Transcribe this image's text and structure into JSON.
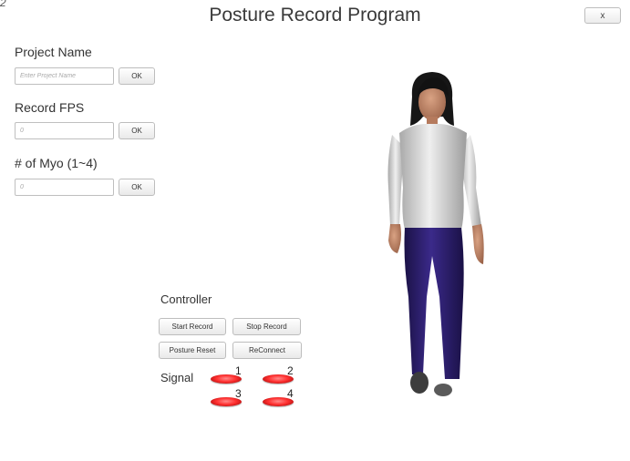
{
  "window": {
    "title": "Posture Record Program",
    "close_label": "x",
    "corner_mark": "2"
  },
  "project": {
    "label": "Project Name",
    "placeholder": "Enter Project Name",
    "value": "",
    "ok_label": "OK"
  },
  "fps": {
    "label": "Record FPS",
    "placeholder": "0",
    "value": "",
    "ok_label": "OK"
  },
  "myo": {
    "label": "# of Myo (1~4)",
    "placeholder": "0",
    "value": "",
    "ok_label": "OK"
  },
  "controller": {
    "label": "Controller",
    "start_record": "Start Record",
    "stop_record": "Stop Record",
    "posture_reset": "Posture Reset",
    "reconnect": "ReConnect"
  },
  "signal": {
    "label": "Signal",
    "indicators": [
      {
        "number": "1",
        "color": "#ff3030"
      },
      {
        "number": "2",
        "color": "#ff3030"
      },
      {
        "number": "3",
        "color": "#ff3030"
      },
      {
        "number": "4",
        "color": "#ff3030"
      }
    ]
  },
  "colors": {
    "shirt": "#d9d9d9",
    "pants": "#2a1c66",
    "hair": "#1a1a1a",
    "skin": "#c48a6a"
  }
}
